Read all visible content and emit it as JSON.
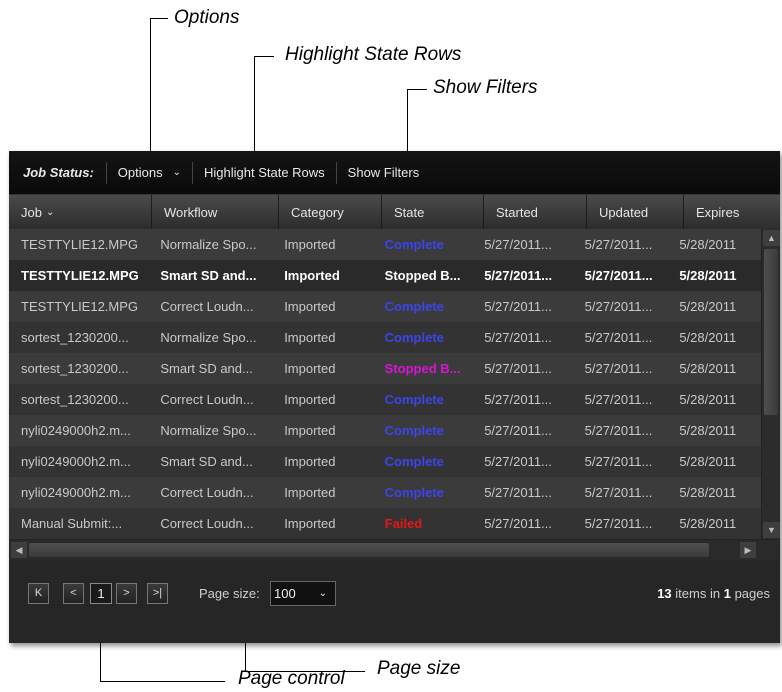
{
  "callouts": {
    "options": "Options",
    "highlight": "Highlight State Rows",
    "filters": "Show Filters",
    "page_size": "Page size",
    "page_control": "Page control"
  },
  "toolbar": {
    "title": "Job Status:",
    "options": "Options",
    "highlight": "Highlight State Rows",
    "show_filters": "Show Filters"
  },
  "columns": [
    "Job",
    "Workflow",
    "Category",
    "State",
    "Started",
    "Updated",
    "Expires"
  ],
  "state_colors": {
    "Complete": "#3d45e8",
    "Stopped": "#d814d8",
    "Failed": "#e41616",
    "Highlighted": "#ffffff"
  },
  "rows": [
    {
      "job": "TESTTYLIE12.MPG",
      "workflow": "Normalize Spo...",
      "category": "Imported",
      "state": "Complete",
      "state_color": "#3d45e8",
      "started": "5/27/2011...",
      "updated": "5/27/2011...",
      "expires": "5/28/2011"
    },
    {
      "job": "TESTTYLIE12.MPG",
      "workflow": "Smart SD and...",
      "category": "Imported",
      "state": "Stopped B...",
      "state_color": "#ffffff",
      "started": "5/27/2011...",
      "updated": "5/27/2011...",
      "expires": "5/28/2011",
      "bold": true
    },
    {
      "job": "TESTTYLIE12.MPG",
      "workflow": "Correct Loudn...",
      "category": "Imported",
      "state": "Complete",
      "state_color": "#3d45e8",
      "started": "5/27/2011...",
      "updated": "5/27/2011...",
      "expires": "5/28/2011"
    },
    {
      "job": "sortest_1230200...",
      "workflow": "Normalize Spo...",
      "category": "Imported",
      "state": "Complete",
      "state_color": "#3d45e8",
      "started": "5/27/2011...",
      "updated": "5/27/2011...",
      "expires": "5/28/2011"
    },
    {
      "job": "sortest_1230200...",
      "workflow": "Smart SD and...",
      "category": "Imported",
      "state": "Stopped B...",
      "state_color": "#d814d8",
      "started": "5/27/2011...",
      "updated": "5/27/2011...",
      "expires": "5/28/2011"
    },
    {
      "job": "sortest_1230200...",
      "workflow": "Correct Loudn...",
      "category": "Imported",
      "state": "Complete",
      "state_color": "#3d45e8",
      "started": "5/27/2011...",
      "updated": "5/27/2011...",
      "expires": "5/28/2011"
    },
    {
      "job": "nyli0249000h2.m...",
      "workflow": "Normalize Spo...",
      "category": "Imported",
      "state": "Complete",
      "state_color": "#3d45e8",
      "started": "5/27/2011...",
      "updated": "5/27/2011...",
      "expires": "5/28/2011"
    },
    {
      "job": "nyli0249000h2.m...",
      "workflow": "Smart SD and...",
      "category": "Imported",
      "state": "Complete",
      "state_color": "#3d45e8",
      "started": "5/27/2011...",
      "updated": "5/27/2011...",
      "expires": "5/28/2011"
    },
    {
      "job": "nyli0249000h2.m...",
      "workflow": "Correct Loudn...",
      "category": "Imported",
      "state": "Complete",
      "state_color": "#3d45e8",
      "started": "5/27/2011...",
      "updated": "5/27/2011...",
      "expires": "5/28/2011"
    },
    {
      "job": "Manual Submit:...",
      "workflow": "Correct Loudn...",
      "category": "Imported",
      "state": "Failed",
      "state_color": "#e41616",
      "started": "5/27/2011...",
      "updated": "5/27/2011...",
      "expires": "5/28/2011"
    }
  ],
  "pager": {
    "first_icon": "first-page-icon",
    "prev_icon": "prev-page-icon",
    "next_icon": "next-page-icon",
    "last_icon": "last-page-icon",
    "current_page": "1",
    "page_size_label": "Page size:",
    "page_size_value": "100",
    "items_count": "13",
    "items_text": "items in",
    "pages_count": "1",
    "pages_text": "pages"
  }
}
